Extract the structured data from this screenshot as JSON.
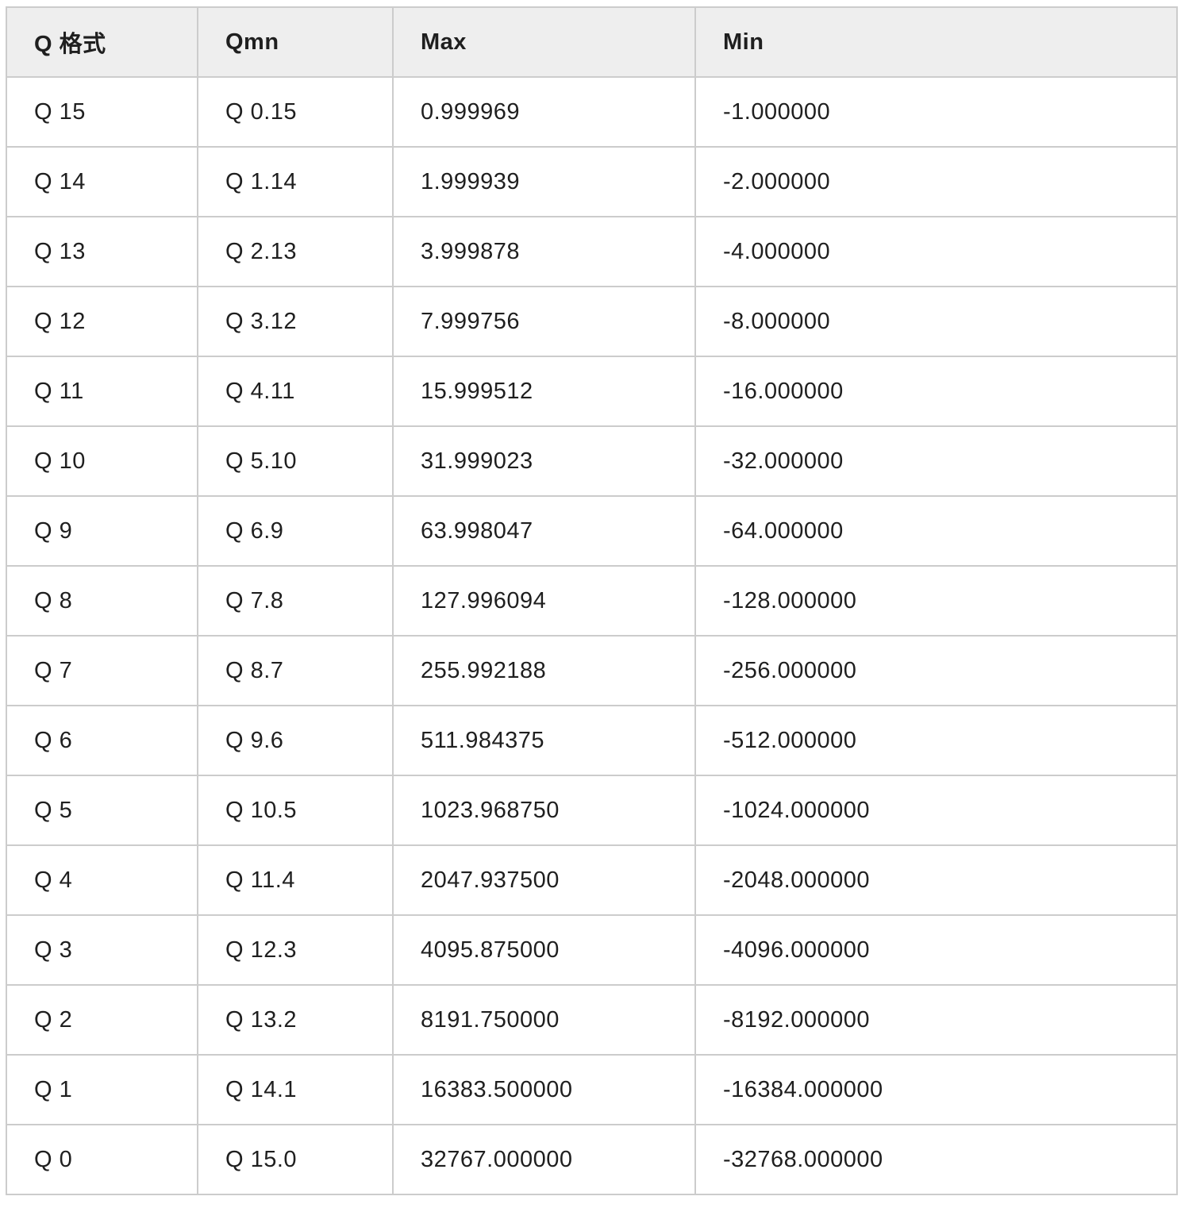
{
  "table": {
    "headers": [
      "Q 格式",
      "Qmn",
      "Max",
      "Min"
    ],
    "rows": [
      [
        "Q 15",
        "Q 0.15",
        "0.999969",
        "-1.000000"
      ],
      [
        "Q 14",
        "Q 1.14",
        "1.999939",
        "-2.000000"
      ],
      [
        "Q 13",
        "Q 2.13",
        "3.999878",
        "-4.000000"
      ],
      [
        "Q 12",
        "Q 3.12",
        "7.999756",
        "-8.000000"
      ],
      [
        "Q 11",
        "Q 4.11",
        "15.999512",
        "-16.000000"
      ],
      [
        "Q 10",
        "Q 5.10",
        "31.999023",
        "-32.000000"
      ],
      [
        "Q 9",
        "Q 6.9",
        "63.998047",
        "-64.000000"
      ],
      [
        "Q 8",
        "Q 7.8",
        "127.996094",
        "-128.000000"
      ],
      [
        "Q 7",
        "Q 8.7",
        "255.992188",
        "-256.000000"
      ],
      [
        "Q 6",
        "Q 9.6",
        "511.984375",
        "-512.000000"
      ],
      [
        "Q 5",
        "Q 10.5",
        "1023.968750",
        "-1024.000000"
      ],
      [
        "Q 4",
        "Q 11.4",
        "2047.937500",
        "-2048.000000"
      ],
      [
        "Q 3",
        "Q 12.3",
        "4095.875000",
        "-4096.000000"
      ],
      [
        "Q 2",
        "Q 13.2",
        "8191.750000",
        "-8192.000000"
      ],
      [
        "Q 1",
        "Q 14.1",
        "16383.500000",
        "-16384.000000"
      ],
      [
        "Q 0",
        "Q 15.0",
        "32767.000000",
        "-32768.000000"
      ]
    ]
  }
}
